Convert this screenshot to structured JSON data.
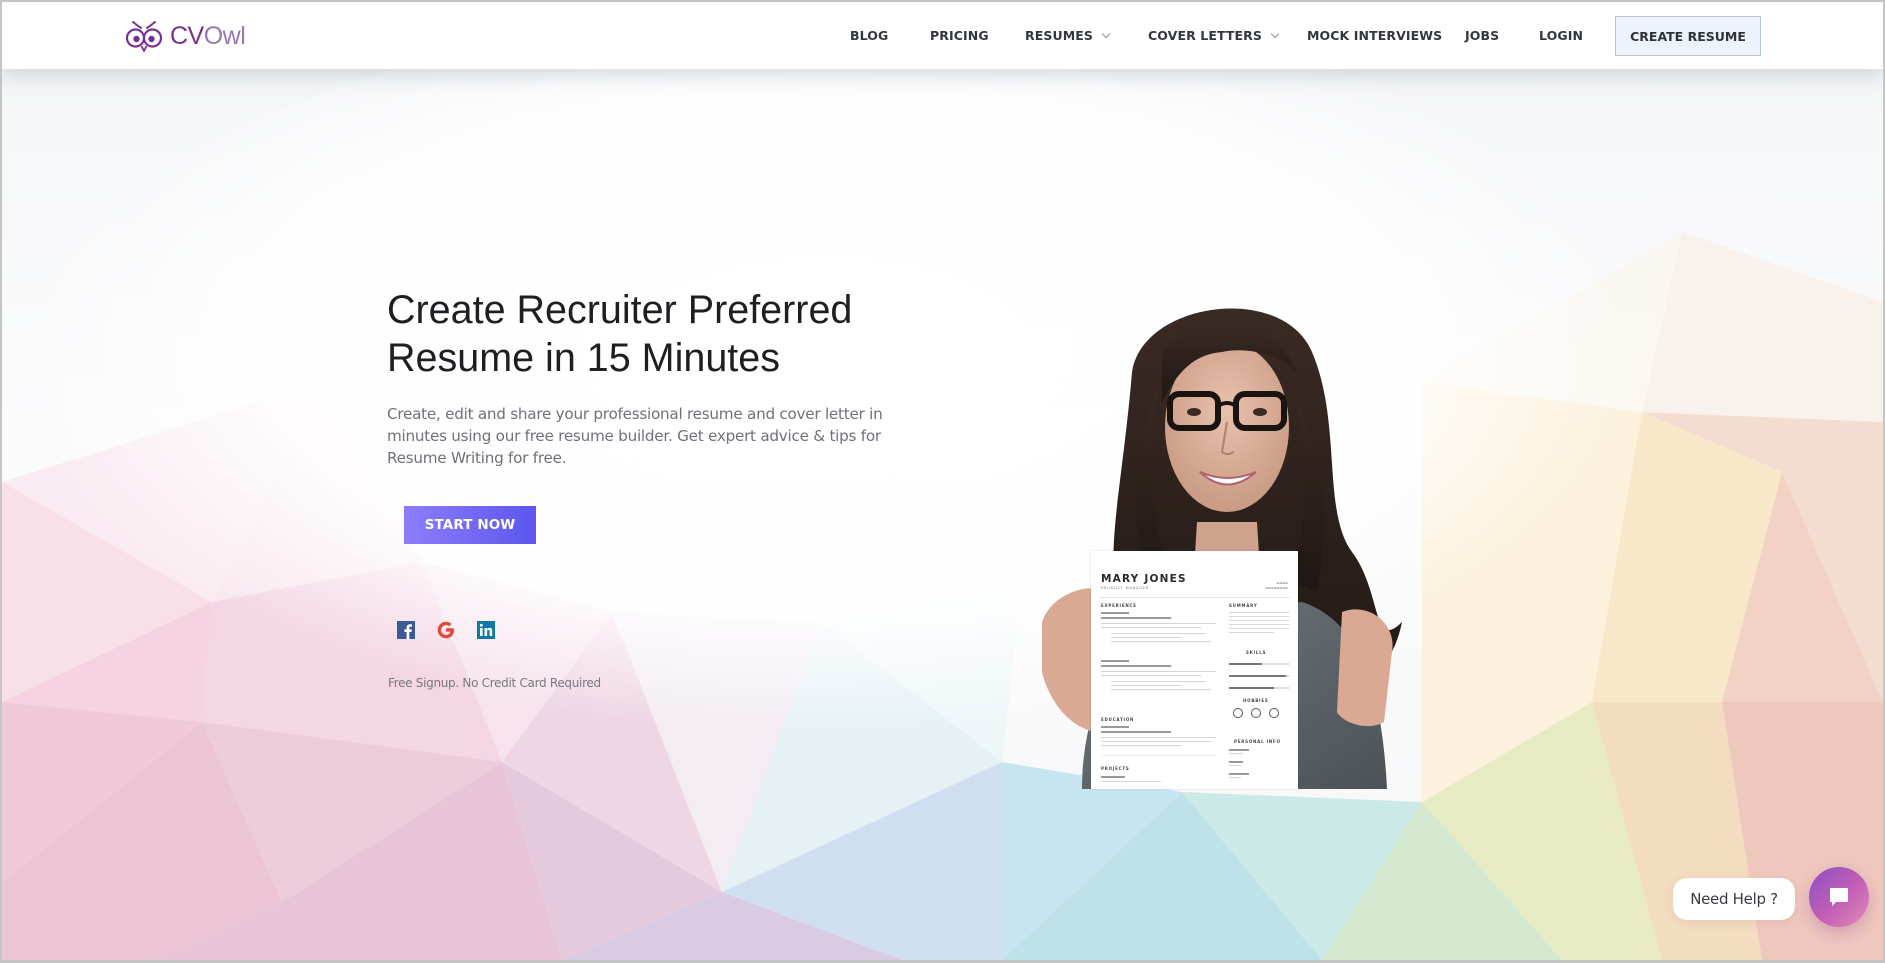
{
  "brand": {
    "name_part1": "CV",
    "name_part2": "Owl",
    "logo_icon": "owl-face-icon",
    "colors": {
      "primary_purple": "#7a2f93",
      "cta_gradient_start": "#8c7dfb",
      "cta_gradient_end": "#5d57f0",
      "create_resume_bg": "#edf3fb",
      "chat_gradient_start": "#8c4fc6",
      "chat_gradient_end": "#e58bb8"
    }
  },
  "nav": {
    "items": [
      {
        "label": "BLOG",
        "has_dropdown": false
      },
      {
        "label": "PRICING",
        "has_dropdown": false
      },
      {
        "label": "RESUMES",
        "has_dropdown": true
      },
      {
        "label": "COVER LETTERS",
        "has_dropdown": true
      },
      {
        "label": "MOCK INTERVIEWS",
        "has_dropdown": false
      },
      {
        "label": "JOBS",
        "has_dropdown": false
      },
      {
        "label": "LOGIN",
        "has_dropdown": false
      }
    ],
    "cta_label": "CREATE RESUME"
  },
  "hero": {
    "title_line1": "Create Recruiter Preferred",
    "title_line2": "Resume in 15 Minutes",
    "subtitle_line1": "Create, edit and share your professional resume and cover letter in",
    "subtitle_line2": "minutes using our free resume builder. Get expert advice & tips for",
    "subtitle_line3": "Resume Writing for free.",
    "start_button": "START NOW",
    "social_icons": [
      "facebook-icon",
      "google-icon",
      "linkedin-icon"
    ],
    "footnote": "Free Signup. No Credit Card Required"
  },
  "hero_image": {
    "description": "Smiling woman with glasses holding a printed resume",
    "resume": {
      "name": "MARY JONES",
      "role": "PRODUCT MANAGER",
      "sections_left": [
        "EXPERIENCE",
        "EDUCATION",
        "PROJECTS"
      ],
      "sections_right": [
        "SUMMARY",
        "SKILLS",
        "HOBBIES",
        "PERSONAL INFO"
      ]
    }
  },
  "help_widget": {
    "label": "Need Help ?",
    "icon": "chat-bubble-icon"
  }
}
